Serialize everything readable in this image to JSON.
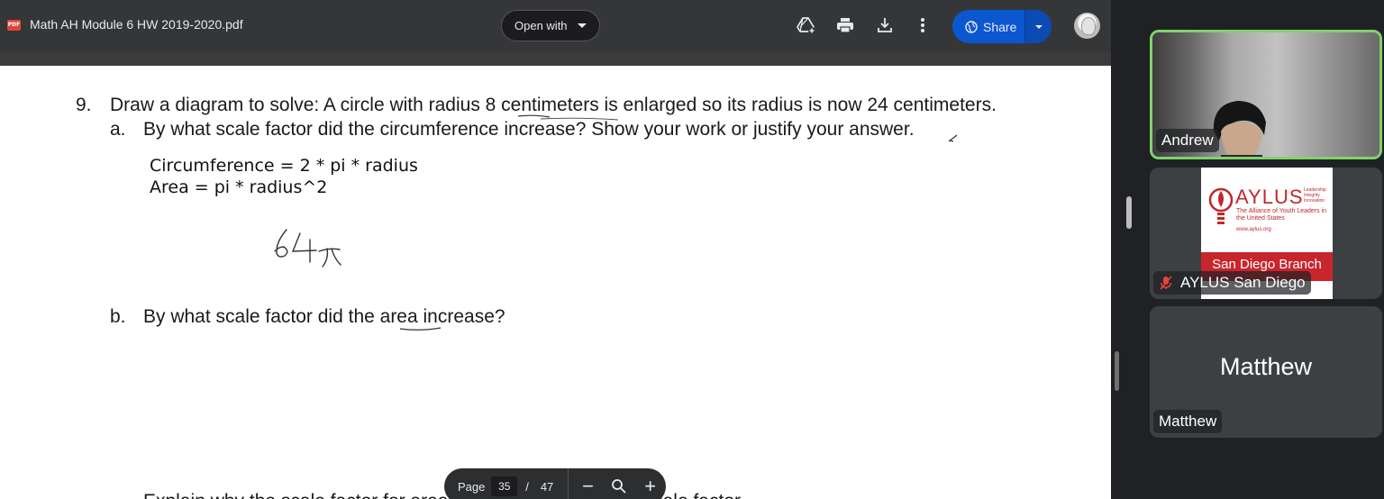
{
  "viewer": {
    "file_badge": "PDF",
    "file_title": "Math AH Module 6 HW 2019-2020.pdf",
    "open_with_label": "Open with",
    "share_label": "Share",
    "icons": [
      "add-to-drive-icon",
      "print-icon",
      "download-icon",
      "more-vert-icon",
      "globe-icon"
    ]
  },
  "document": {
    "q9_number": "9.",
    "q9_text": "Draw a diagram to solve: A circle with radius 8 centimeters is enlarged so its radius is now 24 centimeters.",
    "qa_letter": "a.",
    "qa_text": "By what scale factor did the circumference increase? Show your work or justify your answer.",
    "typed_line1": "Circumference = 2 * pi * radius",
    "typed_line2": "Area = pi * radius^2",
    "handwritten_answer": "64π",
    "qb_letter": "b.",
    "qb_text": "By what scale factor did the area increase?",
    "cut_line": "Explain why the scale factor for area is not the same as the scale factor"
  },
  "page_nav": {
    "page_label": "Page",
    "current_page": "35",
    "separator": "/",
    "total_pages": "47",
    "zoom_out": "−",
    "zoom_in": "+"
  },
  "meet": {
    "participants": [
      {
        "name": "Andrew",
        "active_speaker": true
      },
      {
        "name": "AYLUS San Diego",
        "muted": true
      },
      {
        "name": "Matthew"
      }
    ],
    "matthew_display": "Matthew",
    "aylus_logo": {
      "word": "AYLUS",
      "taglines": [
        "Leadership",
        "Integrity",
        "Innovation"
      ],
      "sub1": "The Alliance of Youth Leaders in the United States",
      "url": "www.aylus.org",
      "branch": "San Diego Branch"
    },
    "active_color": "#7fd36a"
  }
}
